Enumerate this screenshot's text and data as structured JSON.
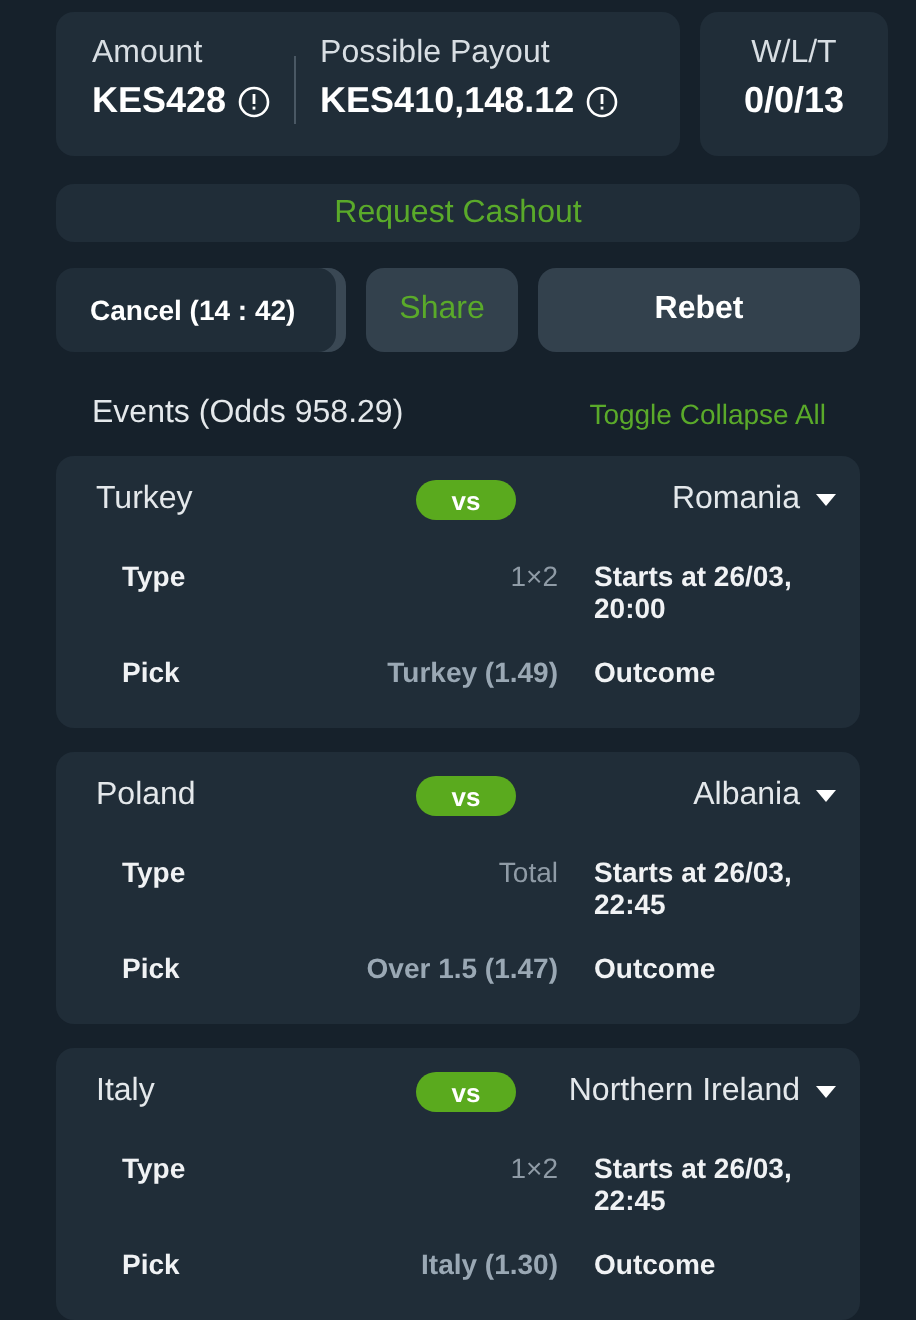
{
  "summary": {
    "amount": {
      "label": "Amount",
      "value": "KES428"
    },
    "payout": {
      "label": "Possible Payout",
      "value": "KES410,148.12"
    },
    "wlt": {
      "label": "W/L/T",
      "value": "0/0/13"
    }
  },
  "cashout_button": "Request Cashout",
  "actions": {
    "cancel": "Cancel (14 : 42)",
    "share": "Share",
    "rebet": "Rebet"
  },
  "events_header": {
    "title": "Events (Odds 958.29)",
    "toggle": "Toggle Collapse All"
  },
  "events": [
    {
      "home": "Turkey",
      "vs": "vs",
      "away": "Romania",
      "rows": [
        {
          "label": "Type",
          "value": "1×2",
          "info": "Starts at 26/03, 20:00"
        },
        {
          "label": "Pick",
          "value": "Turkey (1.49)",
          "info": "Outcome"
        }
      ]
    },
    {
      "home": "Poland",
      "vs": "vs",
      "away": "Albania",
      "rows": [
        {
          "label": "Type",
          "value": "Total",
          "info": "Starts at 26/03, 22:45"
        },
        {
          "label": "Pick",
          "value": "Over 1.5 (1.47)",
          "info": "Outcome"
        }
      ]
    },
    {
      "home": "Italy",
      "vs": "vs",
      "away": "Northern Ireland",
      "rows": [
        {
          "label": "Type",
          "value": "1×2",
          "info": "Starts at 26/03, 22:45"
        },
        {
          "label": "Pick",
          "value": "Italy (1.30)",
          "info": "Outcome"
        }
      ]
    }
  ]
}
